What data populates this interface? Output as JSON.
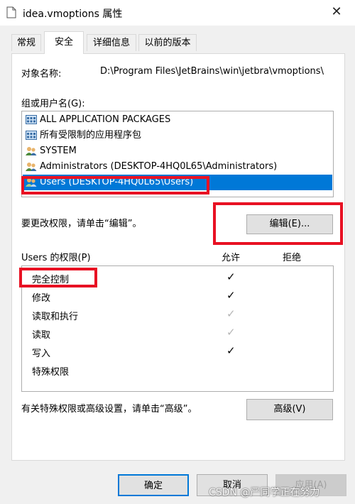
{
  "window": {
    "title": "idea.vmoptions 属性"
  },
  "tabs": [
    {
      "label": "常规"
    },
    {
      "label": "安全"
    },
    {
      "label": "详细信息"
    },
    {
      "label": "以前的版本"
    }
  ],
  "object": {
    "label": "对象名称:",
    "value": "D:\\Program Files\\JetBrains\\win\\jetbra\\vmoptions\\"
  },
  "groups": {
    "label": "组或用户名(G):",
    "items": [
      {
        "label": "ALL APPLICATION PACKAGES",
        "icon": "app-packages-icon"
      },
      {
        "label": "所有受限制的应用程序包",
        "icon": "app-packages-icon"
      },
      {
        "label": "SYSTEM",
        "icon": "users-icon"
      },
      {
        "label": "Administrators (DESKTOP-4HQ0L65\\Administrators)",
        "icon": "users-icon"
      },
      {
        "label": "Users (DESKTOP-4HQ0L65\\Users)",
        "icon": "users-icon",
        "selected": true
      }
    ]
  },
  "edit": {
    "hint": "要更改权限，请单击“编辑”。",
    "button": "编辑(E)..."
  },
  "permissions": {
    "label": "Users 的权限(P)",
    "allow_header": "允许",
    "deny_header": "拒绝",
    "rows": [
      {
        "name": "完全控制",
        "allow": "✓",
        "inherited": false
      },
      {
        "name": "修改",
        "allow": "✓",
        "inherited": false
      },
      {
        "name": "读取和执行",
        "allow": "✓",
        "inherited": true
      },
      {
        "name": "读取",
        "allow": "✓",
        "inherited": true
      },
      {
        "name": "写入",
        "allow": "✓",
        "inherited": false
      },
      {
        "name": "特殊权限",
        "allow": "",
        "inherited": false
      }
    ]
  },
  "advanced": {
    "hint": "有关特殊权限或高级设置，请单击“高级”。",
    "button": "高级(V)"
  },
  "footer": {
    "ok": "确定",
    "cancel": "取消",
    "apply": "应用(A)"
  },
  "watermark": "CSDN @严同学正在努力",
  "colors": {
    "selection": "#0078d7",
    "highlight": "#e81123"
  }
}
